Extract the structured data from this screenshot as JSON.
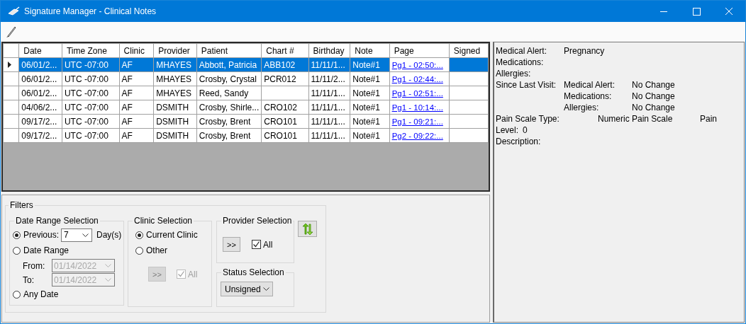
{
  "window": {
    "title": "Signature Manager - Clinical Notes"
  },
  "grid": {
    "columns": [
      "Date",
      "Time Zone",
      "Clinic",
      "Provider",
      "Patient",
      "Chart #",
      "Birthday",
      "Note",
      "Page",
      "Signed"
    ],
    "rows": [
      {
        "selected": true,
        "cells": [
          "06/01/2...",
          "UTC -07:00",
          "AF",
          "MHAYES",
          "Abbott, Patricia",
          "ABB102",
          "11/11/1...",
          "Note#1",
          "Pg1 - 02:50:...",
          ""
        ]
      },
      {
        "selected": false,
        "cells": [
          "06/01/2...",
          "UTC -07:00",
          "AF",
          "MHAYES",
          "Crosby, Crystal",
          "PCR012",
          "11/11/2...",
          "Note#1",
          "Pg1 - 02:44:...",
          ""
        ]
      },
      {
        "selected": false,
        "cells": [
          "06/01/2...",
          "UTC -07:00",
          "AF",
          "MHAYES",
          "Reed, Sandy",
          "",
          "11/11/1...",
          "Note#1",
          "Pg1 - 02:51:...",
          ""
        ]
      },
      {
        "selected": false,
        "cells": [
          "04/06/2...",
          "UTC -07:00",
          "AF",
          "DSMITH",
          "Crosby, Shirle...",
          "CRO102",
          "11/11/1...",
          "Note#1",
          "Pg1 - 10:14:...",
          ""
        ]
      },
      {
        "selected": false,
        "cells": [
          "09/17/2...",
          "UTC -07:00",
          "AF",
          "DSMITH",
          "Crosby, Brent",
          "CRO101",
          "11/11/1...",
          "Note#1",
          "Pg1 - 09:21:...",
          ""
        ]
      },
      {
        "selected": false,
        "cells": [
          "09/17/2...",
          "UTC -07:00",
          "AF",
          "DSMITH",
          "Crosby, Brent",
          "CRO101",
          "11/11/1...",
          "Note#1",
          "Pg2 - 09:22:...",
          ""
        ]
      }
    ]
  },
  "filters": {
    "title": "Filters",
    "date_range": {
      "title": "Date Range Selection",
      "options": [
        {
          "kind": "previous",
          "label": "Previous:",
          "selected": true,
          "value": "7",
          "unit": "Day(s)"
        },
        {
          "kind": "range",
          "label": "Date Range",
          "selected": false,
          "from_label": "From:",
          "from_value": "01/14/2022",
          "to_label": "To:",
          "to_value": "01/14/2022",
          "disabled": true
        },
        {
          "kind": "any",
          "label": "Any Date",
          "selected": false
        }
      ]
    },
    "clinic": {
      "title": "Clinic Selection",
      "options": [
        {
          "label": "Current Clinic",
          "selected": true
        },
        {
          "label": "Other",
          "selected": false
        }
      ],
      "button": ">>",
      "all_label": "All",
      "all_checked": true,
      "disabled": true
    },
    "provider": {
      "title": "Provider Selection",
      "button": ">>",
      "all_label": "All",
      "all_checked": true,
      "disabled": false
    },
    "status": {
      "title": "Status Selection",
      "value": "Unsigned"
    }
  },
  "details": [
    {
      "kind": "simple",
      "label": "Medical Alert:",
      "value": "Pregnancy"
    },
    {
      "kind": "simple",
      "label": "Medications:"
    },
    {
      "kind": "simple",
      "label": "Allergies:"
    },
    {
      "kind": "since",
      "label": "Since Last Visit:",
      "sublabel": "Medical Alert:",
      "value": "No Change"
    },
    {
      "kind": "since",
      "sublabel": "Medications:",
      "value": "No Change"
    },
    {
      "kind": "since",
      "sublabel": "Allergies:",
      "value": "No Change"
    },
    {
      "kind": "pain",
      "label": "Pain Scale Type:",
      "value": "Numeric Pain Scale",
      "extra": "Pain"
    },
    {
      "kind": "level",
      "label": "Level:",
      "value": "0"
    },
    {
      "kind": "simple",
      "label": "Description:"
    }
  ]
}
